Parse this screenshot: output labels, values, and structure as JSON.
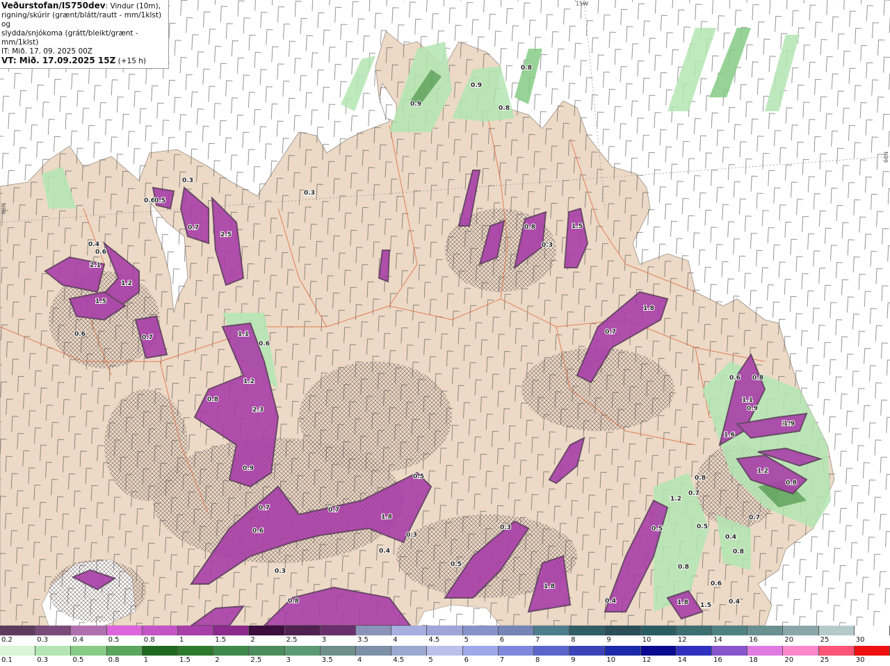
{
  "header": {
    "title": "Veðurstofan/IS750dev",
    "line1": ": Vindur (10m),",
    "line2": "rigning/skúrir (grænt/blátt/rautt - mm/1klst) og",
    "line3": "slydda/snjókoma (grátt/bleikt/grænt - mm/1klst)",
    "it": "IT: Mið. 17. 09. 2025 00Z",
    "vt_prefix": "VT: Mið. 17.09.2025 15Z",
    "vt_suffix": " (+15 h)"
  },
  "map_edges": {
    "top": "15W",
    "left": "66N",
    "right": "66N"
  },
  "precip_labels": [
    "0.5",
    "0.6",
    "0.5",
    "0.9",
    "0.9",
    "0.8",
    "0.8",
    "0.3",
    "0.3",
    "2.5",
    "0.7",
    "0.6",
    "1.5",
    "0.8",
    "0.3",
    "0.4",
    "2.1",
    "1.2",
    "1.5",
    "0.6",
    "0.7",
    "1.1",
    "0.6",
    "1.8",
    "0.7",
    "0.8",
    "1.2",
    "2.3",
    "0.9",
    "0.7",
    "0.6",
    "0.7",
    "1.8",
    "0.5",
    "0.3",
    "0.4",
    "0.3",
    "0.5",
    "1.8",
    "0.5",
    "0.4",
    "0.8",
    "0.6",
    "1.9",
    "0.7",
    "0.8",
    "1.1",
    "0.9",
    "1.6",
    "1.9",
    "1.2",
    "0.8",
    "0.7",
    "0.8",
    "0.6",
    "1.2",
    "0.8",
    "0.5",
    "0.4",
    "1.8",
    "1.5",
    "0.3",
    "0.4",
    "0.8"
  ],
  "scale_snow": {
    "colors": [
      "#5e3a5e",
      "#7a4a7a",
      "#b070b0",
      "#dd66dd",
      "#c455c4",
      "#a93fa9",
      "#8c2a8c",
      "#3d0d3d",
      "#4f2150",
      "#6a2e6b",
      "#8b94b8",
      "#a7aee0",
      "#9fa5d8",
      "#8792c9",
      "#7585b6",
      "#4e7e8e",
      "#2f5e66",
      "#2b4e58",
      "#2a5d62",
      "#3d6f72",
      "#4f8183",
      "#6a8f91",
      "#89a6a8",
      "#b7cacb",
      "#ffffff"
    ],
    "labels": [
      "0.2",
      "0.3",
      "0.4",
      "0.5",
      "0.8",
      "1",
      "1.5",
      "2",
      "2.5",
      "3",
      "3.5",
      "4",
      "4.5",
      "5",
      "6",
      "7",
      "8",
      "9",
      "10",
      "12",
      "14",
      "16",
      "20",
      "25",
      "30"
    ]
  },
  "scale_rain": {
    "colors": [
      "#d8f5d8",
      "#b3e6b3",
      "#86cc86",
      "#5aa65a",
      "#1f6a1f",
      "#2c7a2c",
      "#3f8a4a",
      "#4a8c5c",
      "#5c9a76",
      "#6c8f8a",
      "#7d90a8",
      "#9aa7cf",
      "#b9c0ea",
      "#9ea8ea",
      "#7d88dc",
      "#5a66cc",
      "#3a44b8",
      "#1a2aa8",
      "#0a0a90",
      "#3030c0",
      "#8855cc",
      "#e07ae0",
      "#ff88cc",
      "#ff5577",
      "#ee1111"
    ],
    "labels": [
      "0.1",
      "0.3",
      "0.5",
      "0.8",
      "1",
      "1.5",
      "2",
      "2.5",
      "3",
      "3.5",
      "4",
      "4.5",
      "5",
      "6",
      "7",
      "8",
      "9",
      "10",
      "12",
      "14",
      "16",
      "18",
      "20",
      "25",
      "30"
    ]
  }
}
